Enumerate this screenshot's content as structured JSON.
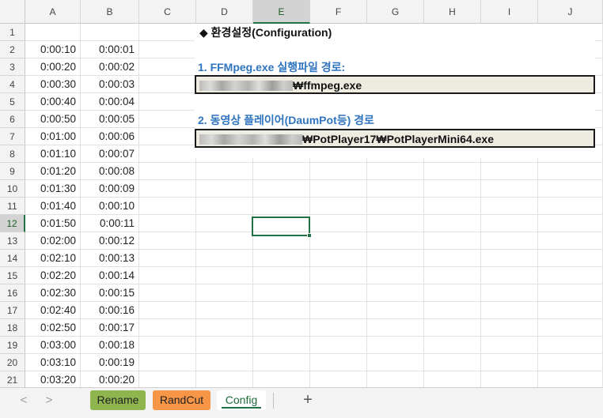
{
  "columns": [
    "A",
    "B",
    "C",
    "D",
    "E",
    "F",
    "G",
    "H",
    "I",
    "J"
  ],
  "selected_column": "E",
  "rows": [
    "1",
    "2",
    "3",
    "4",
    "5",
    "6",
    "7",
    "8",
    "9",
    "10",
    "11",
    "12",
    "13",
    "14",
    "15",
    "16",
    "17",
    "18",
    "19",
    "20",
    "21"
  ],
  "selected_row": "12",
  "col_a": [
    "",
    "0:00:10",
    "0:00:20",
    "0:00:30",
    "0:00:40",
    "0:00:50",
    "0:01:00",
    "0:01:10",
    "0:01:20",
    "0:01:30",
    "0:01:40",
    "0:01:50",
    "0:02:00",
    "0:02:10",
    "0:02:20",
    "0:02:30",
    "0:02:40",
    "0:02:50",
    "0:03:00",
    "0:03:10",
    "0:03:20"
  ],
  "col_b": [
    "",
    "0:00:01",
    "0:00:02",
    "0:00:03",
    "0:00:04",
    "0:00:05",
    "0:00:06",
    "0:00:07",
    "0:00:08",
    "0:00:09",
    "0:00:10",
    "0:00:11",
    "0:00:12",
    "0:00:13",
    "0:00:14",
    "0:00:15",
    "0:00:16",
    "0:00:17",
    "0:00:18",
    "0:00:19",
    "0:00:20"
  ],
  "config": {
    "title": "◆ 환경설정(Configuration)",
    "ffmpeg_label": "1. FFMpeg.exe 실행파일 경로:",
    "ffmpeg_path_suffix": "₩ffmpeg.exe",
    "player_label": "2. 동영상 플레이어(DaumPot등) 경로",
    "player_path_suffix": "₩PotPlayer17₩PotPlayerMini64.exe"
  },
  "tabs": {
    "prev_arrow": "<",
    "next_arrow": ">",
    "rename": "Rename",
    "randcut": "RandCut",
    "config": "Config",
    "add": "+",
    "rename_color": "#8fb64e",
    "randcut_color": "#f79646"
  }
}
